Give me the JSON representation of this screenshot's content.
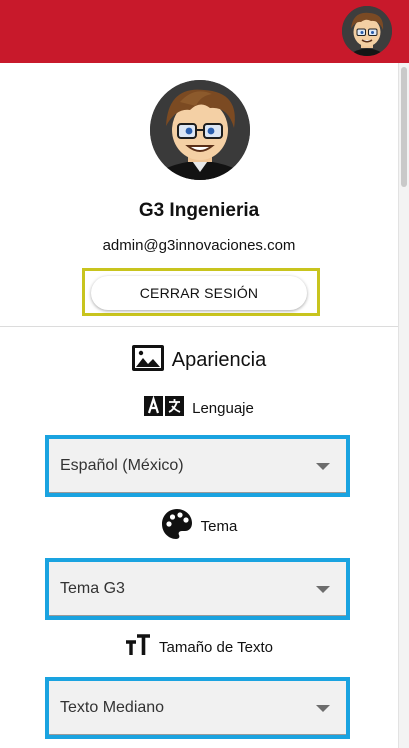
{
  "header": {
    "avatar_icon": "user-avatar-icon",
    "brand_color": "#c8192b"
  },
  "profile": {
    "name": "G3 Ingenieria",
    "email": "admin@g3innovaciones.com",
    "logout_label": "CERRAR SESIÓN"
  },
  "appearance": {
    "heading": "Apariencia",
    "heading_icon": "image-icon",
    "language": {
      "label": "Lenguaje",
      "icon": "translate-icon",
      "value": "Español (México)"
    },
    "theme": {
      "label": "Tema",
      "icon": "palette-icon",
      "value": "Tema G3"
    },
    "text_size": {
      "label": "Tamaño de Texto",
      "icon": "text-size-icon",
      "value": "Texto Mediano"
    }
  },
  "colors": {
    "highlight_yellow": "#c8c41e",
    "highlight_blue": "#1aa3e0"
  }
}
